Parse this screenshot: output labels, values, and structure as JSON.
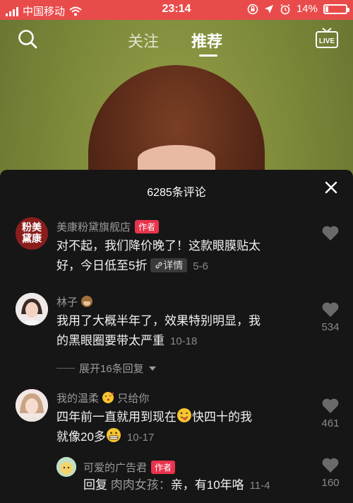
{
  "status_bar": {
    "carrier": "中国移动",
    "time": "23:14",
    "battery": "14%",
    "battery_level": 0.14
  },
  "nav": {
    "tab_follow": "关注",
    "tab_recommend": "推荐",
    "live_label": "LIVE"
  },
  "panel": {
    "title": "6285条评论",
    "comments": [
      {
        "author": "美康粉黛旗舰店",
        "badge": "作者",
        "avatar_text": "粉美黛康",
        "line1": "对不起，我们降价晚了！这款眼膜贴太",
        "line2": "好，今日低至5折",
        "detail_chip": "详情",
        "date": "5-6",
        "likes": ""
      },
      {
        "author": "林子",
        "line1": "我用了大概半年了，效果特别明显，我",
        "line2": "的黑眼圈要带太严重",
        "date": "10-18",
        "likes": "534",
        "expand": "展开16条回复"
      },
      {
        "author": "我的温柔",
        "author_suffix": "只给你",
        "line1": "四年前一直就用到现在",
        "line1b": "快四十的我",
        "line2": "就像20多",
        "date": "10-17",
        "likes": "461"
      },
      {
        "author": "可爱的广告君",
        "badge": "作者",
        "reply_prefix": "回复",
        "reply_to": "肉肉女孩：",
        "text": "亲，有10年咯",
        "date": "11-4",
        "likes": "160"
      }
    ]
  },
  "colors": {
    "status_bar": "#e94b4b",
    "panel_bg": "#161616",
    "author_badge": "#e8344d",
    "muted": "#8a8a8a"
  }
}
